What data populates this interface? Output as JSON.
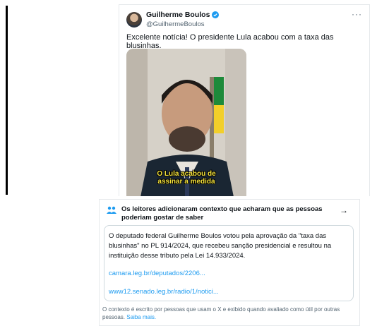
{
  "tweet": {
    "author_name": "Guilherme Boulos",
    "handle": "@GuilhermeBoulos",
    "text": "Excelente notícia! O presidente Lula acabou com a taxa das blusinhas.",
    "more_icon": "more-dots-icon",
    "verified_icon": "verified-badge-icon",
    "video_caption": "O Lula acabou de\nassinar a medida"
  },
  "community_note": {
    "header_icon": "people-icon",
    "title": "Os leitores adicionaram contexto que acharam que as pessoas poderiam gostar de saber",
    "arrow_icon": "arrow-right-icon",
    "body": "O deputado federal Guilherme Boulos votou pela aprovação da \"taxa das blusinhas\" no PL 914/2024, que recebeu sanção presidencial e resultou na instituição desse tributo pela Lei 14.933/2024.",
    "links": [
      "camara.leg.br/deputados/2206...",
      "www12.senado.leg.br/radio/1/notici..."
    ],
    "footer_text": "O contexto é escrito por pessoas que usam o X e exibido quando avaliado como útil por outras pessoas.",
    "footer_link": "Saiba mais."
  },
  "colors": {
    "accent": "#1d9bf0",
    "text": "#0f1419",
    "muted": "#536471",
    "caption": "#f4e23b"
  }
}
